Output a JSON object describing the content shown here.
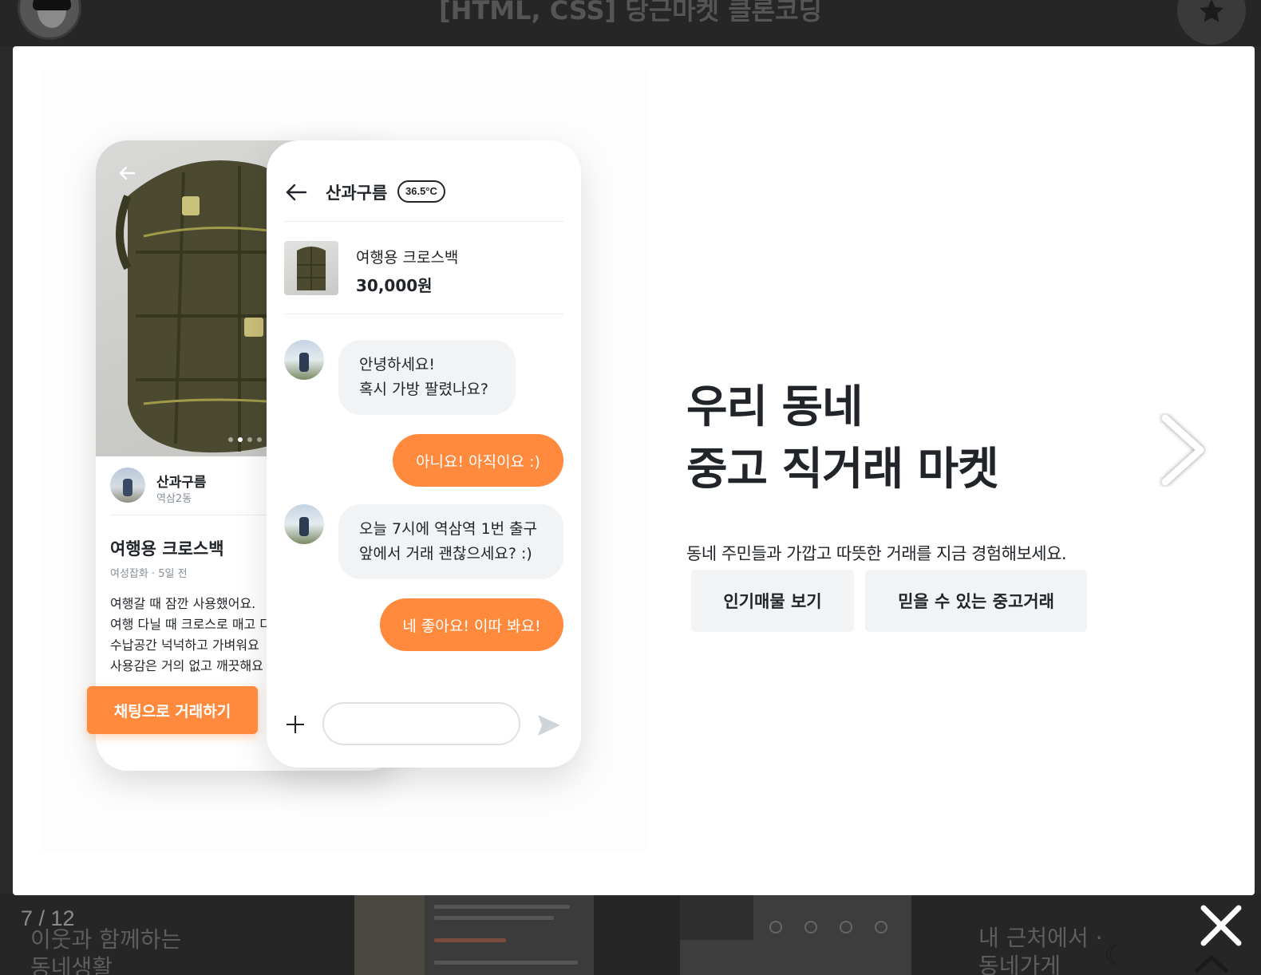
{
  "page_header": {
    "title": "[HTML, CSS] 당근마켓 클론코딩"
  },
  "gallery": {
    "counter": "7 / 12"
  },
  "background_snippets": {
    "left_text": "이웃과 함께하는\n동네생활",
    "right_text": "내 근처에서 ·\n동네가게"
  },
  "slide": {
    "product_screen": {
      "seller_name": "산과구름",
      "seller_location": "역삼2동",
      "product_title": "여행용 크로스백",
      "product_meta": "여성잡화 · 5일 전",
      "description": "여행갈 때 잠깐 사용했어요.\n여행 다닐 때 크로스로 매고 다\n수납공간 넉넉하고 가벼워요\n사용감은 거의 없고 깨끗해요",
      "chat_trade_button": "채팅으로 거래하기"
    },
    "chat_screen": {
      "partner_name": "산과구름",
      "manner_temp": "36.5°C",
      "product_title": "여행용 크로스백",
      "product_price": "30,000원",
      "messages": [
        {
          "from": "other",
          "text": "안녕하세요!\n혹시 가방 팔렸나요?"
        },
        {
          "from": "me",
          "text": "아니요! 아직이요 :)"
        },
        {
          "from": "other",
          "text": "오늘 7시에 역삼역 1번 출구\n앞에서 거래 괜찮으세요? :)"
        },
        {
          "from": "me",
          "text": "네 좋아요! 이따 봐요!"
        }
      ],
      "input_value": ""
    },
    "headline": "우리 동네\n중고 직거래 마켓",
    "subtext": "동네 주민들과 가깝고 따뜻한 거래를 지금 경험해보세요.",
    "buttons": [
      "인기매물 보기",
      "믿을 수 있는 중고거래"
    ]
  },
  "colors": {
    "accent": "#ff8a3d",
    "overlay": "#2a2a2a",
    "button_bg": "#f1f3f5",
    "text": "#212529"
  },
  "icons": [
    "back-arrow-icon",
    "plus-icon",
    "send-icon",
    "next-arrow-icon",
    "close-icon",
    "star-icon",
    "moon-icon",
    "chevron-up-icon"
  ]
}
